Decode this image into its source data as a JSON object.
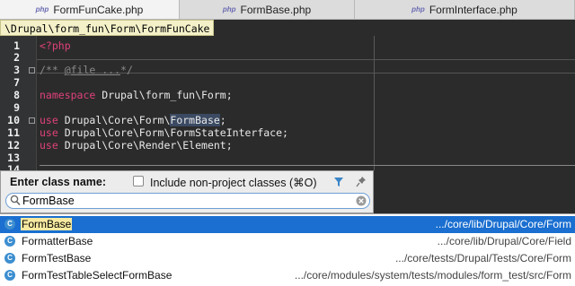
{
  "tabs": [
    {
      "label": "FormFunCake.php",
      "active": true
    },
    {
      "label": "FormBase.php",
      "active": false
    },
    {
      "label": "FormInterface.php",
      "active": false
    }
  ],
  "breadcrumb": "\\Drupal\\form_fun\\Form\\FormFunCake",
  "editor": {
    "line_numbers": [
      "1",
      "2",
      "3",
      "7",
      "8",
      "9",
      "10",
      "11",
      "12",
      "13",
      "14"
    ],
    "lines": {
      "l1": "<?php",
      "l3": "/** ",
      "l3b": "@file ...",
      "l3c": "*/",
      "l8a": "namespace",
      "l8b": " Drupal\\form_fun\\Form;",
      "l10a": "use",
      "l10b": " Drupal\\Core\\Form\\",
      "l10c": "FormBase",
      "l10d": ";",
      "l11a": "use",
      "l11b": " Drupal\\Core\\Form\\FormStateInterface;",
      "l12a": "use",
      "l12b": " Drupal\\Core\\Render\\Element;"
    }
  },
  "popup": {
    "label": "Enter class name:",
    "checkbox_label": "Include non-project classes (⌘O)",
    "search_value": "FormBase"
  },
  "results": [
    {
      "name": "FormBase",
      "path": ".../core/lib/Drupal/Core/Form",
      "selected": true
    },
    {
      "name": "FormatterBase",
      "path": ".../core/lib/Drupal/Core/Field",
      "selected": false
    },
    {
      "name": "FormTestBase",
      "path": ".../core/tests/Drupal/Tests/Core/Form",
      "selected": false
    },
    {
      "name": "FormTestTableSelectFormBase",
      "path": ".../core/modules/system/tests/modules/form_test/src/Form",
      "selected": false
    }
  ],
  "colors": {
    "accent": "#1a6fd0",
    "keyword": "#e0417a"
  }
}
